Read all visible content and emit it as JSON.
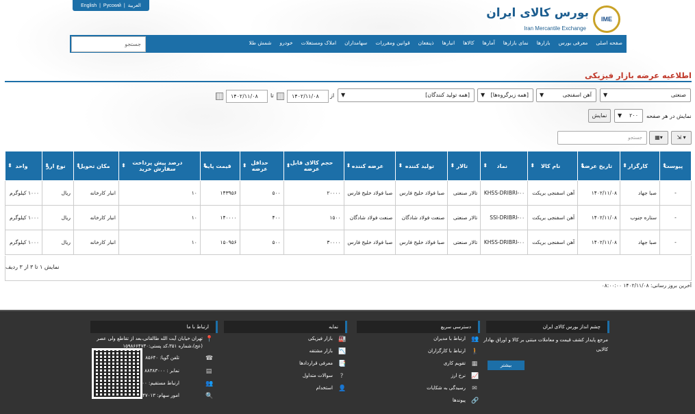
{
  "lang": [
    "English",
    "Русский",
    "العربية"
  ],
  "logo": {
    "fa": "بورس کالای ایران",
    "en": "Iran Mercantile Exchange",
    "mark": "IME"
  },
  "nav": [
    "صفحه اصلی",
    "معرفی بورس",
    "بازارها",
    "نمای بازارها",
    "آمارها",
    "کالاها",
    "انبارها",
    "ذینفعان",
    "قوانین ومقررات",
    "سهامداران",
    "املاک ومستغلات",
    "خودرو",
    "شمش طلا"
  ],
  "nav_search_placeholder": "جستجو",
  "page_title": "اطلاعیه عرضه بازار فیزیکی",
  "filters": {
    "market": "صنعتی",
    "group": "آهن اسفنجی",
    "subgroup": "[همه زیرگروه‌ها]",
    "producer": "[همه تولید کنندگان]",
    "from_label": "از",
    "from_date": "۱۴۰۲/۱۱/۰۸",
    "to_label": "تا",
    "to_date": "۱۴۰۲/۱۱/۰۸",
    "per_page_label": "نمایش در هر صفحه",
    "per_page": "۲۰۰",
    "show_button": "نمایش",
    "grid_search_placeholder": "جستجو"
  },
  "table": {
    "headers": [
      "پیوست",
      "کارگزار",
      "تاریخ عرضه",
      "نام کالا",
      "نماد",
      "تالار",
      "تولید کننده",
      "عرضه کننده",
      "حجم کالای قابل عرضه",
      "حداقل عرضه",
      "قیمت پایه",
      "درصد پیش پرداخت سفارش خرید",
      "مکان تحویل",
      "نوع ارز",
      "واحد"
    ],
    "rows": [
      [
        "-",
        "صبا جهاد",
        "۱۴۰۲/۱۱/۰۸",
        "آهن اسفنجی بریکت",
        "KHSS-DRIBRI-۰۰",
        "تالار صنعتی",
        "صبا فولاد خلیج فارس",
        "صبا فولاد خلیج فارس",
        "۲۰۰۰۰",
        "۵۰۰",
        "۱۴۳۹۵۶",
        "۱۰",
        "انبار کارخانه",
        "ریال",
        "۱۰۰۰ کیلوگرم"
      ],
      [
        "-",
        "ستاره جنوب",
        "۱۴۰۲/۱۱/۰۸",
        "آهن اسفنجی بریکت",
        "SSI-DRIBRI-۰۰",
        "تالار صنعتی",
        "صنعت فولاد شادگان",
        "صنعت فولاد شادگان",
        "۱۵۰۰",
        "۴۰۰",
        "۱۴۰۰۰۰",
        "۱۰",
        "انبار کارخانه",
        "ریال",
        "۱۰۰۰ کیلوگرم"
      ],
      [
        "-",
        "صبا جهاد",
        "۱۴۰۲/۱۱/۰۸",
        "آهن اسفنجی بریکت",
        "KHSS-DRIBRI-۰۰",
        "تالار صنعتی",
        "صبا فولاد خلیج فارس",
        "صبا فولاد خلیج فارس",
        "۳۰۰۰۰",
        "۵۰۰",
        "۱۵۰۹۵۶",
        "۱۰",
        "انبار کارخانه",
        "ریال",
        "۱۰۰۰ کیلوگرم"
      ]
    ]
  },
  "pager_info": "نمایش ۱ تا ۳ از ۳ ردیف",
  "last_update": "آخرین بروز رسانی: ۱۴۰۲/۱۱/۰۸ ۰۸:۰۰:۰۰",
  "footer": {
    "about": {
      "title": "چشم انداز بورس کالای ایران",
      "text1": "مرجع پایدار کشف قیمت و معاملات مبتنی بر کالا و اوراق بهادار",
      "text2": "کالایی",
      "more": "بیشتر"
    },
    "quick": {
      "title": "دسترسی سریع",
      "items": [
        "ارتباط با مدیران",
        "ارتباط با کارگزاران",
        "تقویم کاری",
        "نرخ ارز",
        "رسیدگی به شکایات",
        "پیوندها"
      ]
    },
    "market": {
      "title": "نمایه",
      "items": [
        "بازار فیزیکی",
        "بازار مشتقه",
        "معرفی قراردادها",
        "سوالات متداول",
        "استخدام"
      ]
    },
    "contact": {
      "title": "ارتباط با ما",
      "address1": "تهران خیابان آیت الله طالقانی،بعد از تقاطع ولی عصر",
      "address2": "(عج)،شماره ۳۵۱،کد پستی:۱۵۹۸۶۶۴۷۳۰",
      "phone": "تلفن گویا: ۸۵۶۴۰",
      "fax": "نمابر : ۸۸۳۸۳۰۰۰",
      "direct": "ارتباط مستقیم: ۸۵۶۴۲۲۰۰",
      "shares": "امور سهام: ۸۵۶۴۷۰۱۳"
    }
  }
}
